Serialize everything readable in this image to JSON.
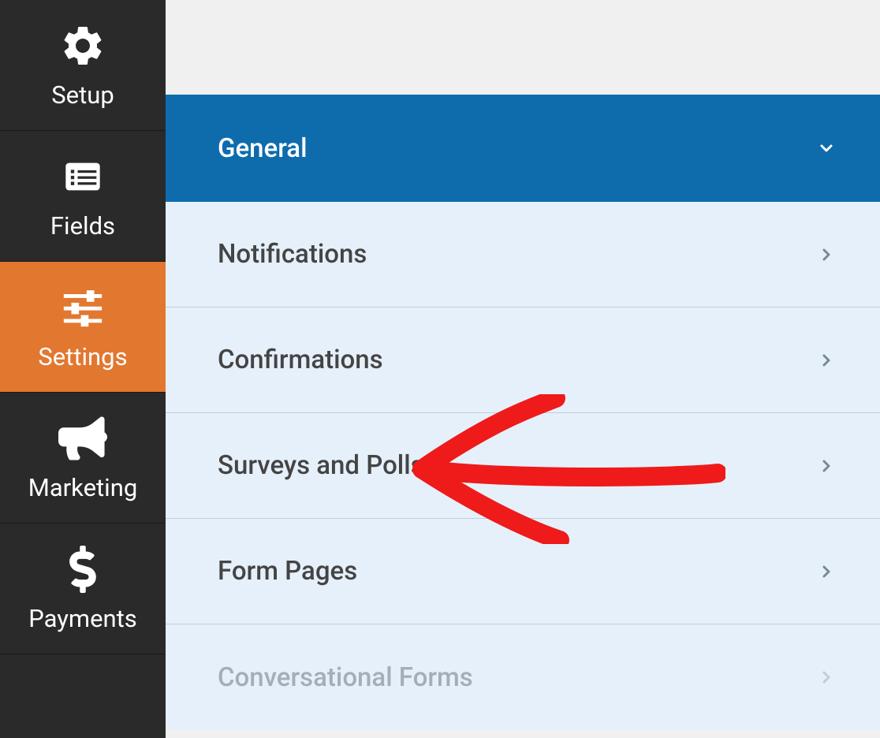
{
  "sidebar": {
    "items": [
      {
        "label": "Setup",
        "icon": "gear"
      },
      {
        "label": "Fields",
        "icon": "list"
      },
      {
        "label": "Settings",
        "icon": "sliders",
        "active": true
      },
      {
        "label": "Marketing",
        "icon": "bullhorn"
      },
      {
        "label": "Payments",
        "icon": "dollar"
      }
    ]
  },
  "settings": {
    "items": [
      {
        "label": "General",
        "expanded": true
      },
      {
        "label": "Notifications"
      },
      {
        "label": "Confirmations"
      },
      {
        "label": "Surveys and Polls"
      },
      {
        "label": "Form Pages",
        "highlighted": true
      },
      {
        "label": "Conversational Forms",
        "disabled": true
      }
    ]
  }
}
